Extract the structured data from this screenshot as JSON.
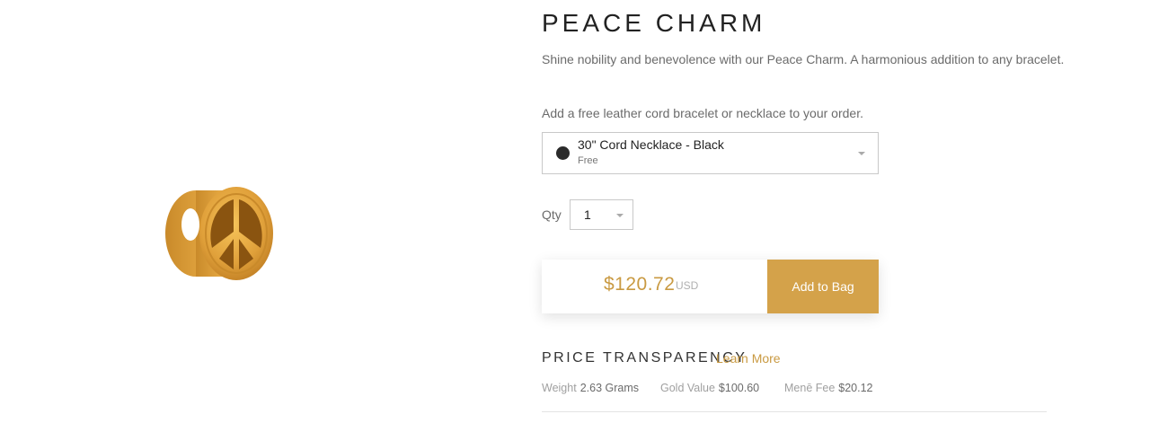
{
  "product": {
    "title": "PEACE CHARM",
    "description": "Shine nobility and benevolence with our Peace Charm. A harmonious addition to any bracelet.",
    "image_icon": "gold-peace-charm-icon"
  },
  "addon": {
    "label": "Add a free leather cord bracelet or necklace to your order.",
    "selected_name": "30\" Cord Necklace - Black",
    "selected_price": "Free",
    "swatch_color": "#2b2b2b"
  },
  "quantity": {
    "label": "Qty",
    "value": "1"
  },
  "purchase": {
    "price": "$120.72",
    "currency": "USD",
    "add_label": "Add to Bag",
    "accent_color": "#d4a24a"
  },
  "transparency": {
    "title": "PRICE TRANSPARENCY",
    "learn_more": "Learn More",
    "weight_label": "Weight",
    "weight_value": "2.63 Grams",
    "gold_label": "Gold Value",
    "gold_value": "$100.60",
    "fee_label": "Menē Fee",
    "fee_value": "$20.12"
  }
}
